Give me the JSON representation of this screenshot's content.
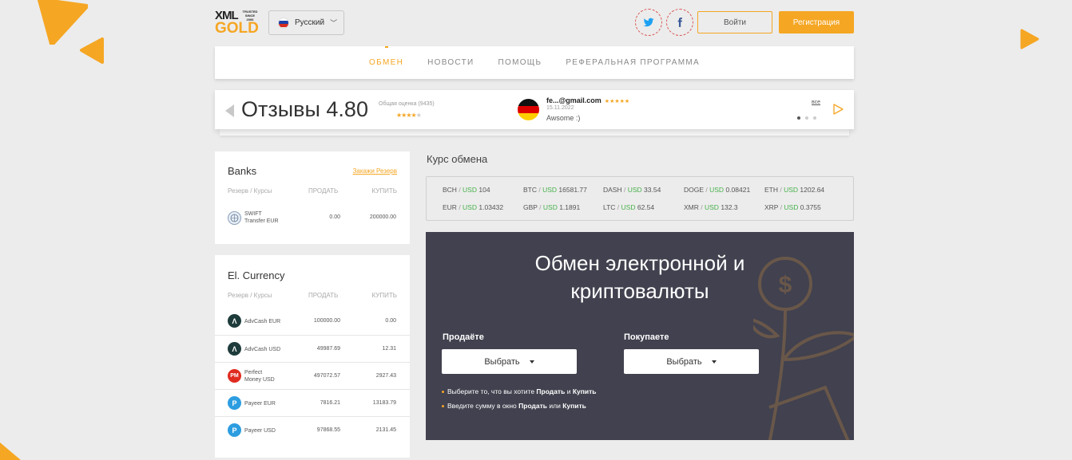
{
  "logo": {
    "xml": "XML",
    "trusted": "TRUSTED SINCE 2006",
    "gold": "GOLD"
  },
  "header": {
    "language": "Русский",
    "login_label": "Войти",
    "register_label": "Регистрация"
  },
  "nav": {
    "items": [
      {
        "label": "ОБМЕН",
        "active": true
      },
      {
        "label": "НОВОСТИ",
        "active": false
      },
      {
        "label": "ПОМОЩЬ",
        "active": false
      },
      {
        "label": "РЕФЕРАЛЬНАЯ ПРОГРАММА",
        "active": false
      }
    ]
  },
  "reviews": {
    "title": "Отзывы 4.80",
    "total_label": "Общая оценка (9435)",
    "rating_stars": "★★★★",
    "rating_stars_empty": "★",
    "review": {
      "user": "fe...@gmail.com",
      "stars": "★★★★★",
      "date": "15.11.2022",
      "text": "Awsome :)"
    },
    "all_link": "все"
  },
  "banks": {
    "title": "Banks",
    "reserve_link": "Закажи Резерв",
    "headers": {
      "reserve": "Резерв / Курсы",
      "sell": "ПРОДАТЬ",
      "buy": "КУПИТЬ"
    },
    "rows": [
      {
        "name_line1": "SWIFT",
        "name_line2": "Transfer EUR",
        "sell": "0.00",
        "buy": "200000.00",
        "icon": "swift-icon"
      }
    ]
  },
  "el_currency": {
    "title": "El. Currency",
    "headers": {
      "reserve": "Резерв / Курсы",
      "sell": "ПРОДАТЬ",
      "buy": "КУПИТЬ"
    },
    "rows": [
      {
        "name_line1": "AdvCash EUR",
        "name_line2": "",
        "sell": "100000.00",
        "buy": "0.00",
        "icon": "advcash-icon",
        "icon_glyph": "Λ",
        "color": "#1d3b3a"
      },
      {
        "name_line1": "AdvCash USD",
        "name_line2": "",
        "sell": "49987.69",
        "buy": "12.31",
        "icon": "advcash-icon",
        "icon_glyph": "Λ",
        "color": "#1d3b3a"
      },
      {
        "name_line1": "Perfect",
        "name_line2": "Money USD",
        "sell": "497072.57",
        "buy": "2927.43",
        "icon": "perfect-money-icon",
        "icon_glyph": "PM",
        "color": "#e02b20"
      },
      {
        "name_line1": "Payeer EUR",
        "name_line2": "",
        "sell": "7816.21",
        "buy": "13183.79",
        "icon": "payeer-icon",
        "icon_glyph": "P",
        "color": "#2c9de0"
      },
      {
        "name_line1": "Payeer USD",
        "name_line2": "",
        "sell": "97868.55",
        "buy": "2131.45",
        "icon": "payeer-icon",
        "icon_glyph": "P",
        "color": "#2c9de0"
      }
    ]
  },
  "rates": {
    "title": "Курс обмена",
    "items": [
      {
        "base": "BCH",
        "quote": "USD",
        "value": "104"
      },
      {
        "base": "BTC",
        "quote": "USD",
        "value": "16581.77"
      },
      {
        "base": "DASH",
        "quote": "USD",
        "value": "33.54"
      },
      {
        "base": "DOGE",
        "quote": "USD",
        "value": "0.08421"
      },
      {
        "base": "ETH",
        "quote": "USD",
        "value": "1202.64"
      },
      {
        "base": "EUR",
        "quote": "USD",
        "value": "1.03432"
      },
      {
        "base": "GBP",
        "quote": "USD",
        "value": "1.1891"
      },
      {
        "base": "LTC",
        "quote": "USD",
        "value": "62.54"
      },
      {
        "base": "XMR",
        "quote": "USD",
        "value": "132.3"
      },
      {
        "base": "XRP",
        "quote": "USD",
        "value": "0.3755"
      }
    ]
  },
  "exchange": {
    "title_line1": "Обмен электронной и",
    "title_line2": "криптовалюты",
    "sell_label": "Продаёте",
    "buy_label": "Покупаете",
    "select_label": "Выбрать",
    "hint1": {
      "pre": "Выберите то, что вы хотите ",
      "b1": "Продать",
      "mid": " и ",
      "b2": "Купить"
    },
    "hint2": {
      "pre": "Введите сумму в окно ",
      "b1": "Продать",
      "mid": " или ",
      "b2": "Купить"
    }
  },
  "colors": {
    "accent": "#f5a623",
    "dark_panel": "#41414f",
    "green": "#46b04a"
  }
}
